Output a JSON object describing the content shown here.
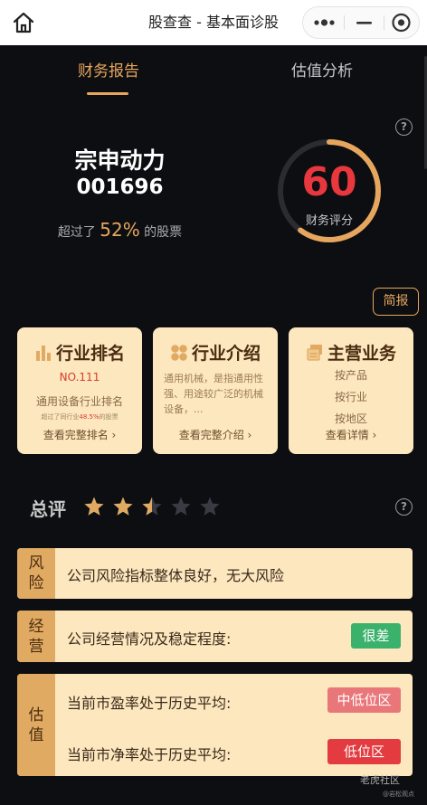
{
  "app": {
    "title": "股查查 - 基本面诊股"
  },
  "tabs": [
    {
      "label": "财务报告",
      "active": true
    },
    {
      "label": "估值分析",
      "active": false
    }
  ],
  "company": {
    "name": "宗申动力",
    "code": "001696",
    "beat_prefix": "超过了",
    "beat_pct": "52%",
    "beat_suffix": "的股票"
  },
  "score": {
    "value": "60",
    "label": "财务评分",
    "fraction": 0.6
  },
  "brief_button": "简报",
  "cards": {
    "industry_rank": {
      "title": "行业排名",
      "rank": "NO.111",
      "label": "通用设备行业排名",
      "sub_prefix": "超过了同行业",
      "sub_pct": "48.5%",
      "sub_suffix": "的股票",
      "link": "查看完整排名 ›"
    },
    "industry_intro": {
      "title": "行业介绍",
      "text": "通用机械，是指通用性强、用途较广泛的机械设备，...",
      "link": "查看完整介绍 ›"
    },
    "main_business": {
      "title": "主营业务",
      "items": [
        "按产品",
        "按行业",
        "按地区"
      ],
      "link": "查看详情 ›"
    }
  },
  "summary": {
    "title": "总评",
    "rating": 2.5,
    "max": 5
  },
  "evaluations": {
    "risk": {
      "tag": "风险",
      "text": "公司风险指标整体良好，无大风险"
    },
    "operation": {
      "tag": "经营",
      "text": "公司经营情况及稳定程度:",
      "badge": "很差"
    },
    "valuation": {
      "tag": "估值",
      "pe_text": "当前市盈率处于历史平均:",
      "pe_badge": "中低位区",
      "pb_text": "当前市净率处于历史平均:",
      "pb_badge": "低位区"
    }
  },
  "watermark": {
    "main": "老虎社区",
    "sub": "@岩松观点"
  },
  "colors": {
    "accent": "#e6a65d",
    "score_red": "#e8383d",
    "badge_green": "#3bb26b",
    "badge_pink": "#e9777a",
    "badge_red": "#e33b3f",
    "card_bg": "#fde7bf",
    "tag_bg": "#e1aa62",
    "page_bg": "#0d0e12"
  },
  "icons": {
    "home": "home-icon",
    "more": "more-dots-icon",
    "minimize": "minimize-icon",
    "close": "target-close-icon",
    "help": "question-circle-icon",
    "rank": "bar-chart-icon",
    "intro": "four-circles-icon",
    "business": "stack-icon",
    "star": "star-icon"
  }
}
